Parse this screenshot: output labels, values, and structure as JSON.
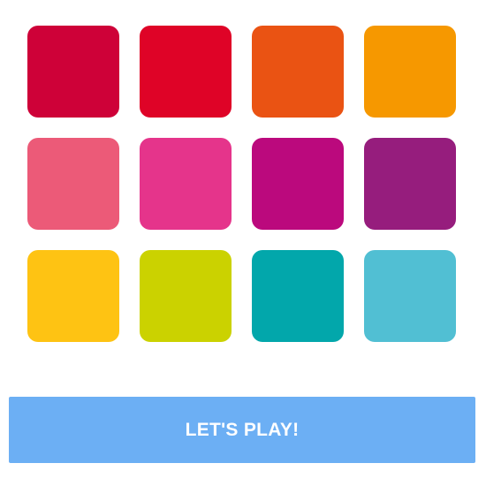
{
  "tiles": [
    {
      "id": "tile-1",
      "color": "#CE0138"
    },
    {
      "id": "tile-2",
      "color": "#DF0327"
    },
    {
      "id": "tile-3",
      "color": "#EA5313"
    },
    {
      "id": "tile-4",
      "color": "#F69800"
    },
    {
      "id": "tile-5",
      "color": "#EC5A78"
    },
    {
      "id": "tile-6",
      "color": "#E5348B"
    },
    {
      "id": "tile-7",
      "color": "#BB097D"
    },
    {
      "id": "tile-8",
      "color": "#961D7D"
    },
    {
      "id": "tile-9",
      "color": "#FEC313"
    },
    {
      "id": "tile-10",
      "color": "#CBD200"
    },
    {
      "id": "tile-11",
      "color": "#02A7AB"
    },
    {
      "id": "tile-12",
      "color": "#51BFD3"
    }
  ],
  "play_button": {
    "label": "LET'S PLAY!",
    "color": "#6CAFF4"
  }
}
